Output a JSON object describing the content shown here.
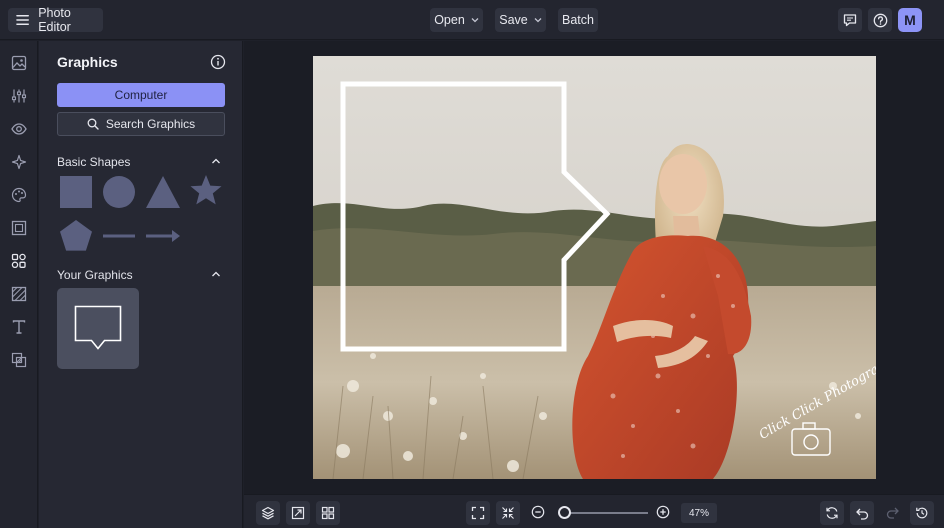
{
  "app": {
    "title": "Photo Editor",
    "avatar_initial": "M"
  },
  "topbar": {
    "open_label": "Open",
    "save_label": "Save",
    "batch_label": "Batch",
    "icons": [
      "menu-icon",
      "chevron-down-icon",
      "chat-icon",
      "help-icon"
    ]
  },
  "rail": {
    "icons": [
      "image-icon",
      "sliders-icon",
      "eye-icon",
      "sparkle-icon",
      "palette-icon",
      "frame-icon",
      "graphics-icon",
      "texture-icon",
      "text-icon",
      "overlay-icon"
    ]
  },
  "panel": {
    "title": "Graphics",
    "computer_label": "Computer",
    "search_label": "Search Graphics",
    "basic_shapes_label": "Basic Shapes",
    "your_graphics_label": "Your Graphics",
    "shapes": [
      "square",
      "circle",
      "triangle",
      "star",
      "pentagon",
      "line",
      "arrow"
    ]
  },
  "canvas": {
    "watermark_text": "Click Click Photography"
  },
  "bottombar": {
    "zoom_label": "47%",
    "zoom": 0.47,
    "icons": [
      "layers-icon",
      "resize-icon",
      "grid-icon",
      "fit-screen-icon",
      "shrink-icon",
      "zoom-out-icon",
      "zoom-in-icon",
      "rotate-icon",
      "undo-icon",
      "redo-icon",
      "history-icon"
    ]
  },
  "colors": {
    "accent": "#8b91f5",
    "background": "#1e2029",
    "panel": "#262833",
    "shape_fill": "#5b6080",
    "photo_dress": "#c84b2f"
  }
}
